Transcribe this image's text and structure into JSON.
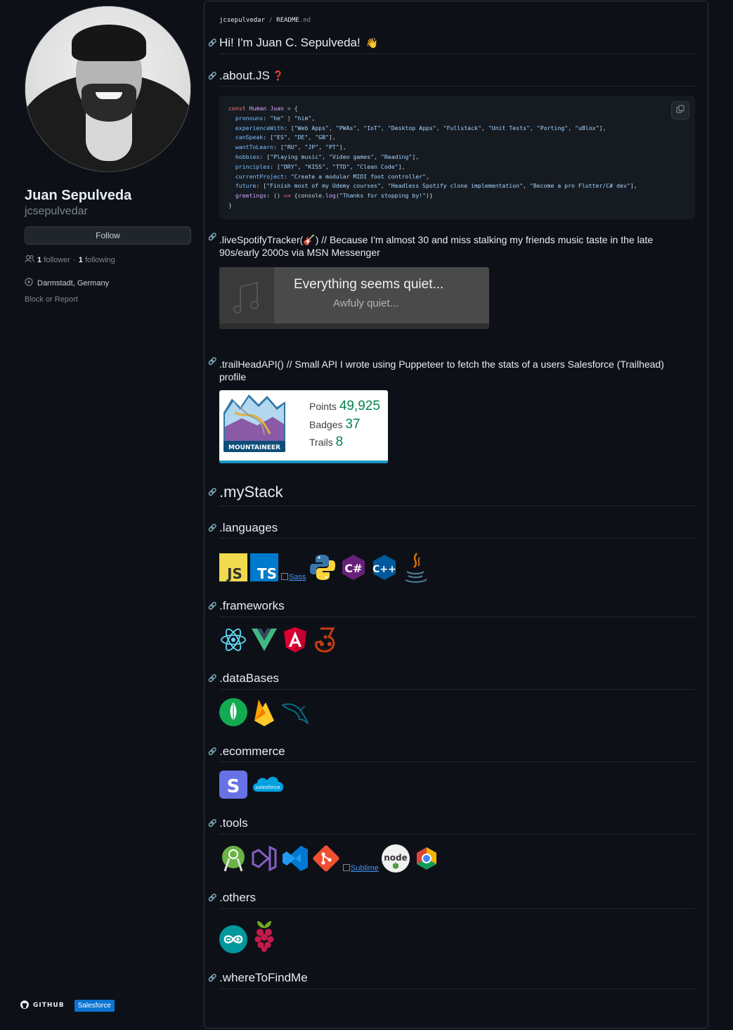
{
  "profile": {
    "full_name": "Juan Sepulveda",
    "username": "jcsepulvedar",
    "follow_label": "Follow",
    "followers_count": "1",
    "followers_label": "follower",
    "following_count": "1",
    "following_label": "following",
    "location": "Darmstadt, Germany",
    "block_label": "Block or Report"
  },
  "readme": {
    "crumb_user": "jcsepulvedar",
    "crumb_sep": "/",
    "crumb_file": "README",
    "crumb_ext": ".md",
    "greeting": "Hi! I'm Juan C. Sepulveda!",
    "greeting_emoji": "👋",
    "about_heading": ".about.JS",
    "about_emoji": "❓",
    "code_lines": [
      "const Human Juan = {",
      "  pronouns: \"he\" | \"him\",",
      "  experienceWith: [\"Web Apps\", \"PWAs\", \"IoT\", \"Desktop Apps\", \"Fullstack\", \"Unit Tests\", \"Porting\", \"uBlox\"],",
      "  canSpeak: [\"ES\", \"DE\", \"GB\"],",
      "  wantToLearn: [\"RU\", \"JP\", \"PT\"],",
      "  hobbies: [\"Playing music\", \"Video games\", \"Reading\"],",
      "  principles: [\"DRY\", \"KISS\", \"TTD\", \"Clean Code\"],",
      "  currentProject: \"Create a modular MIDI foot controller\",",
      "  future: [\"Finish most of my Udemy courses\", \"Headless Spotify clone implementation\", \"Become a pro Flutter/C# dev\"],",
      "  greetings: () => {console.log(\"Thanks for stopping by!\")}",
      "}"
    ],
    "spotify_heading": ".liveSpotifyTracker(🎸) // Because I'm almost 30 and miss stalking my friends music taste in the late 90s/early 2000s via MSN Messenger",
    "spotify_title": "Everything seems quiet...",
    "spotify_sub": "Awfuly quiet...",
    "trail_heading": ".trailHeadAPI() // Small API I wrote using Puppeteer to fetch the stats of a users Salesforce (Trailhead) profile",
    "trail_badge_label": "MOUNTAINEER",
    "trail_points_label": "Points",
    "trail_points": "49,925",
    "trail_badges_label": "Badges",
    "trail_badges": "37",
    "trail_trails_label": "Trails",
    "trail_trails": "8",
    "mystack_heading": ".myStack",
    "languages_heading": ".languages",
    "sass_alt": "Sass",
    "frameworks_heading": ".frameworks",
    "databases_heading": ".dataBases",
    "ecommerce_heading": ".ecommerce",
    "salesforce_logo_text": "salesforce",
    "tools_heading": ".tools",
    "sublime_alt": "Sublime",
    "others_heading": ".others",
    "where_heading": ".whereToFindMe",
    "github_badge": "GITHUB",
    "salesforce_badge": "Salesforce"
  },
  "icons": {
    "languages": [
      "javascript-icon",
      "typescript-icon",
      "sass-icon",
      "python-icon",
      "csharp-icon",
      "cplusplus-icon",
      "java-icon"
    ],
    "frameworks": [
      "react-icon",
      "vue-icon",
      "angular-icon",
      "jest-icon"
    ],
    "databases": [
      "mongodb-icon",
      "firebase-icon",
      "mysql-icon"
    ],
    "ecommerce": [
      "stripe-icon",
      "salesforce-icon"
    ],
    "tools": [
      "android-studio-icon",
      "visual-studio-icon",
      "vscode-icon",
      "git-icon",
      "sublime-icon",
      "nodejs-icon",
      "chrome-devtools-icon"
    ],
    "others": [
      "arduino-icon",
      "raspberry-pi-icon"
    ]
  },
  "colors": {
    "background": "#0d1117",
    "border": "#30363d",
    "text": "#e6edf3",
    "muted": "#7d8590",
    "link": "#4493f8",
    "trail_green": "#04844b",
    "salesforce_blue": "#0b74d4"
  }
}
